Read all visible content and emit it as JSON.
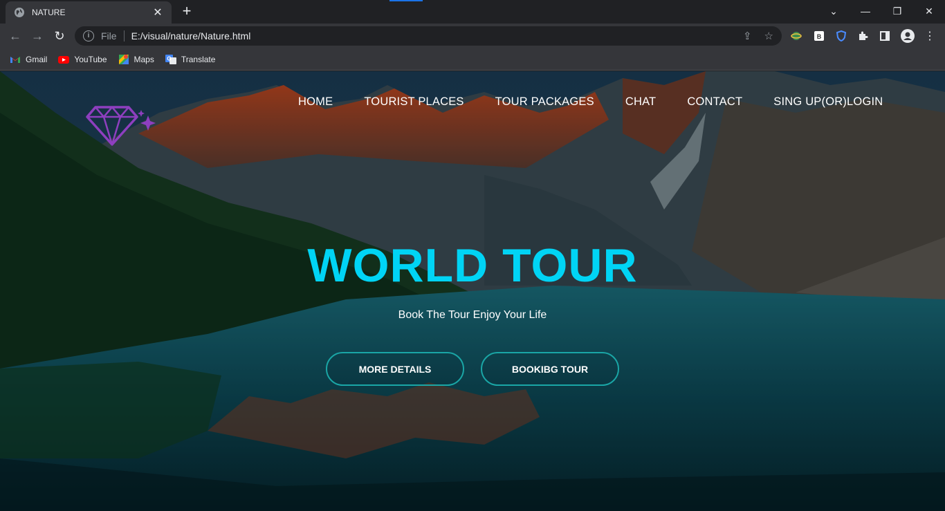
{
  "browser": {
    "tab_title": "NATURE",
    "url_scheme": "File",
    "url": "E:/visual/nature/Nature.html",
    "bookmarks": [
      {
        "label": "Gmail",
        "icon": "gmail-icon"
      },
      {
        "label": "YouTube",
        "icon": "youtube-icon"
      },
      {
        "label": "Maps",
        "icon": "maps-icon"
      },
      {
        "label": "Translate",
        "icon": "translate-icon"
      }
    ],
    "extensions": [
      "extension-globe-icon",
      "extension-b-icon",
      "extension-shield-icon",
      "puzzle-icon",
      "side-panel-icon",
      "profile-icon",
      "menu-dots-icon"
    ]
  },
  "page": {
    "nav": [
      "HOME",
      "TOURIST PLACES",
      "TOUR PACKAGES",
      "CHAT",
      "CONTACT",
      "SING UP(OR)LOGIN"
    ],
    "hero_title": "WORLD TOUR",
    "hero_subtitle": "Book The Tour Enjoy Your Life",
    "buttons": {
      "more": "MORE DETAILS",
      "book": "BOOKIBG TOUR"
    },
    "colors": {
      "accent": "#00d4f5",
      "button_border": "#1aa6a6",
      "logo": "#8e3fbf"
    }
  }
}
